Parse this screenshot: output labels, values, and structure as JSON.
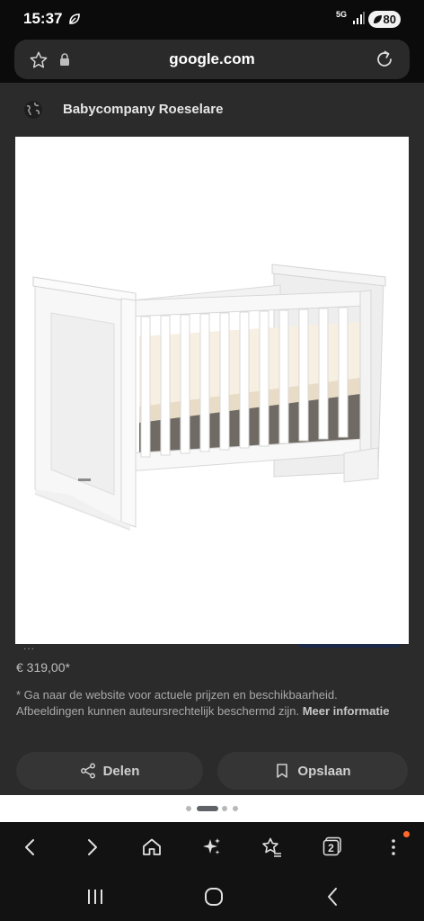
{
  "status_bar": {
    "time": "15:37",
    "network": "5G",
    "battery_level": "80",
    "icons": [
      "leaf-icon",
      "signal-icon",
      "battery-icon"
    ]
  },
  "url_bar": {
    "url": "google.com",
    "icons": [
      "star-icon",
      "lock-icon",
      "reload-icon"
    ]
  },
  "site": {
    "name": "Babycompany Roeselare",
    "icon": "globe-icon"
  },
  "product": {
    "image_alt_icon": "crib-image",
    "price": "€ 319,00*",
    "disclaimer": "* Ga naar de website voor actuele prijzen en beschikbaarheid. Afbeeldingen kunnen auteursrechtelijk beschermd zijn.",
    "more_info": "Meer informatie",
    "truncated_dots": "...",
    "share_label": "Delen",
    "save_label": "Opslaan"
  },
  "carousel": {
    "dot_count": 4,
    "active_index": 1
  },
  "browser_toolbar": {
    "tab_count": "2",
    "icons": [
      "back-icon",
      "forward-icon",
      "home-icon",
      "sparkle-icon",
      "bookmarks-icon",
      "tabs-icon",
      "menu-icon"
    ]
  },
  "nav_bar": {
    "icons": [
      "recent-apps-icon",
      "home-nav-icon",
      "back-nav-icon"
    ]
  },
  "colors": {
    "background": "#121212",
    "card": "#2b2b2b",
    "badge": "#ff6a2b"
  }
}
